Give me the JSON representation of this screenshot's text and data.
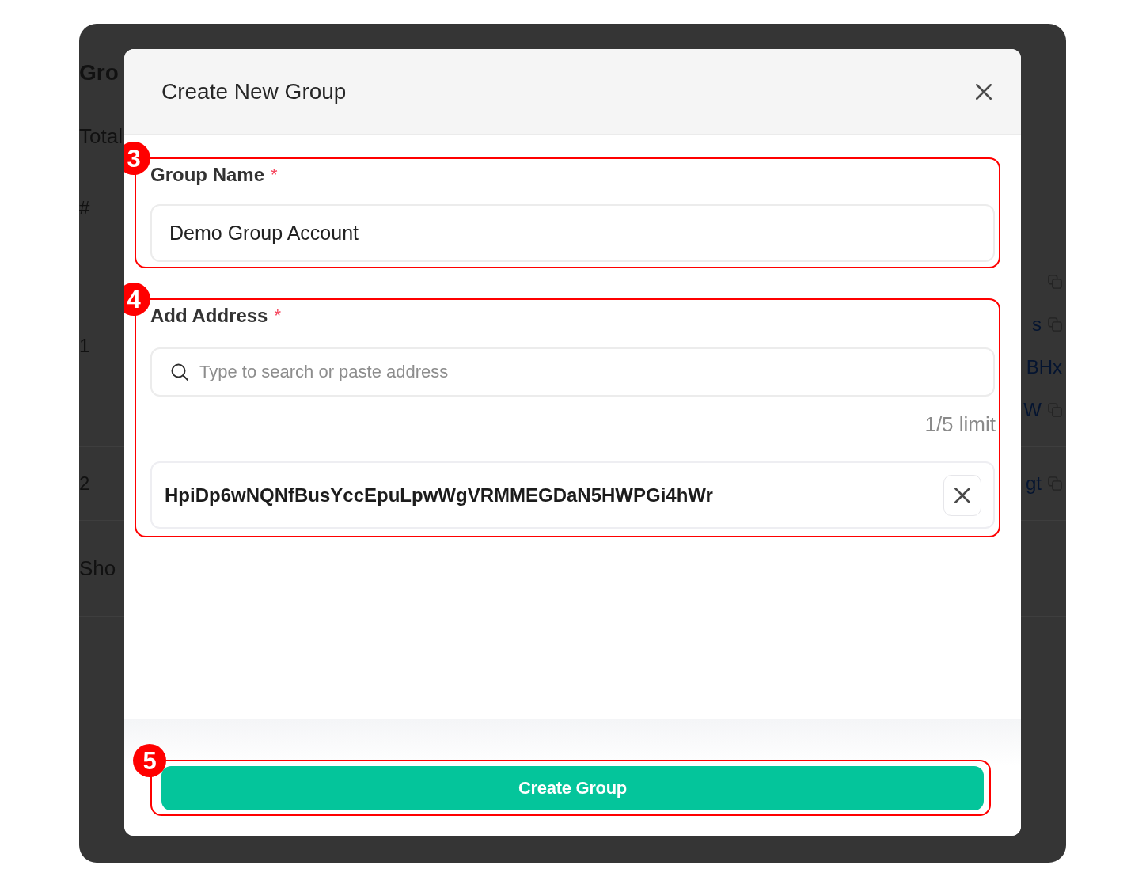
{
  "background_page": {
    "title": "Gro",
    "total": "Total",
    "table": {
      "header": "#",
      "rows": [
        {
          "index": "1",
          "addresses": [
            {
              "copy_icon": true
            },
            {
              "text": "s",
              "copy_icon": true
            },
            {
              "text": "BHx",
              "copy_icon": false
            },
            {
              "text": "W",
              "copy_icon": true
            }
          ]
        },
        {
          "index": "2",
          "addresses": [
            {
              "text": "gt",
              "copy_icon": true
            }
          ]
        }
      ]
    },
    "pagination": "Sho"
  },
  "modal": {
    "title": "Create New Group",
    "fields": [
      {
        "kind": "text",
        "label": "Group Name",
        "required_mark": "*",
        "value": "Demo Group Account",
        "callout": "3"
      },
      {
        "kind": "address",
        "label": "Add Address",
        "required_mark": "*",
        "placeholder": "Type to search or paste address",
        "limit": "1/5 limit",
        "addresses": [
          "HpiDp6wNQNfBusYccEpuLpwWgVRMMEGDaN5HWPGi4hWr"
        ],
        "callout": "4"
      }
    ],
    "submit": {
      "label": "Create Group",
      "callout": "5"
    }
  }
}
